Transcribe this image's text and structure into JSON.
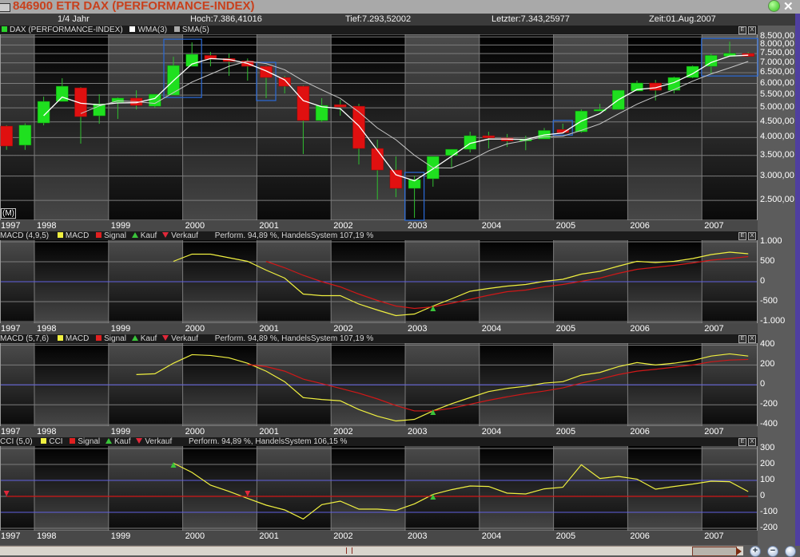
{
  "window": {
    "title": "846900 ETR DAX (PERFORMANCE-INDEX)",
    "period": "1/4 Jahr",
    "high": "Hoch:7.386,41016",
    "low": "Tief:7.293,52002",
    "last": "Letzter:7.343,25977",
    "time": "Zeit:01.Aug.2007",
    "close_label": "✕"
  },
  "main_legend": {
    "series": "DAX (PERFORMANCE-INDEX)",
    "wma": "WMA(3)",
    "sma": "SMA(5)",
    "scale_mode": "(M)"
  },
  "panels": [
    {
      "name": "MACD (4,9,5)",
      "line": "MACD",
      "signal": "Signal",
      "buy": "Kauf",
      "sell": "Verkauf",
      "perf": "Perform. 94,89 %, HandelsSystem 107,19 %"
    },
    {
      "name": "MACD (5,7,6)",
      "line": "MACD",
      "signal": "Signal",
      "buy": "Kauf",
      "sell": "Verkauf",
      "perf": "Perform. 94,89 %, HandelsSystem 107,19 %"
    },
    {
      "name": "CCI (5,0)",
      "line": "CCI",
      "signal": "Signal",
      "buy": "Kauf",
      "sell": "Verkauf",
      "perf": "Perform. 94,89 %, HandelsSystem 106,15 %"
    }
  ],
  "panel_buttons": {
    "menu": "E",
    "close": "X"
  },
  "years": [
    "1997",
    "1998",
    "1999",
    "2000",
    "2001",
    "2002",
    "2003",
    "2004",
    "2005",
    "2006",
    "2007"
  ],
  "zoom_controls": {
    "zoom_in": "+",
    "zoom_out": "−",
    "reset": ""
  },
  "colors": {
    "up": "#1fe01f",
    "down": "#e01010",
    "wick": "#2fc02f",
    "wma": "#ffffff",
    "sma": "#c8c8c8",
    "macd": "#f0f040",
    "signal": "#d01818",
    "buy": "#3ac43a",
    "sell": "#e0283a",
    "highlight": "#2a6ad8",
    "zero_blue": "#6060e0"
  },
  "chart_data": [
    {
      "type": "candlestick",
      "title": "846900 ETR DAX (PERFORMANCE-INDEX)",
      "interval": "quarter",
      "x_start": "1997-Q3",
      "x_end": "2007-Q3",
      "yscale": "log",
      "ylim": [
        2155,
        8665
      ],
      "yticks": [
        {
          "value": 8500,
          "label": "8.500,00"
        },
        {
          "value": 8000,
          "label": "8.000,00"
        },
        {
          "value": 7500,
          "label": "7.500,00"
        },
        {
          "value": 7000,
          "label": "7.000,00"
        },
        {
          "value": 6500,
          "label": "6.500,00"
        },
        {
          "value": 6000,
          "label": "6.000,00"
        },
        {
          "value": 5500,
          "label": "5.500,00"
        },
        {
          "value": 5000,
          "label": "5.000,00"
        },
        {
          "value": 4500,
          "label": "4.500,00"
        },
        {
          "value": 4000,
          "label": "4.000,00"
        },
        {
          "value": 3500,
          "label": "3.500,00"
        },
        {
          "value": 3000,
          "label": "3.000,00"
        },
        {
          "value": 2500,
          "label": "2.500,00"
        }
      ],
      "ohlc": [
        [
          4360,
          4390,
          3650,
          3755
        ],
        [
          3780,
          4450,
          3650,
          4390
        ],
        [
          4464,
          5436,
          4384,
          5245
        ],
        [
          5245,
          6236,
          5245,
          5875
        ],
        [
          5805,
          5840,
          3822,
          4680
        ],
        [
          4710,
          5534,
          4436,
          5150
        ],
        [
          5213,
          5405,
          4600,
          5375
        ],
        [
          5375,
          5700,
          4940,
          5090
        ],
        [
          5060,
          5534,
          5000,
          5534
        ],
        [
          5500,
          7326,
          5500,
          6860
        ],
        [
          6820,
          8158,
          6820,
          7460
        ],
        [
          7400,
          7595,
          6820,
          7196
        ],
        [
          7230,
          7510,
          6350,
          7070
        ],
        [
          7100,
          7230,
          6127,
          6820
        ],
        [
          6820,
          6860,
          5375,
          6273
        ],
        [
          6273,
          6350,
          5567,
          5875
        ],
        [
          5875,
          5910,
          3536,
          4545
        ],
        [
          4545,
          5375,
          4490,
          5090
        ],
        [
          5120,
          5310,
          4710,
          5030
        ],
        [
          5060,
          5150,
          3272,
          3688
        ],
        [
          3688,
          3938,
          2516,
          3138
        ],
        [
          3138,
          3474,
          2562,
          2736
        ],
        [
          2736,
          3010,
          2193,
          2922
        ],
        [
          2940,
          3474,
          2770,
          3474
        ],
        [
          3500,
          3665,
          3200,
          3665
        ],
        [
          3665,
          4180,
          3580,
          4057
        ],
        [
          4057,
          4180,
          3688,
          3990
        ],
        [
          3990,
          4110,
          3730,
          3900
        ],
        [
          3900,
          4057,
          3640,
          3960
        ],
        [
          3960,
          4300,
          3960,
          4220
        ],
        [
          4250,
          4440,
          4150,
          4150
        ],
        [
          4180,
          4940,
          4150,
          4880
        ],
        [
          4880,
          5150,
          4880,
          4940
        ],
        [
          4940,
          5700,
          4940,
          5700
        ],
        [
          5670,
          6127,
          5670,
          6019
        ],
        [
          6019,
          6160,
          5280,
          5700
        ],
        [
          5700,
          6310,
          5567,
          6273
        ],
        [
          6273,
          6860,
          6236,
          6820
        ],
        [
          6820,
          7510,
          6460,
          7400
        ],
        [
          7350,
          8200,
          7350,
          7520
        ],
        [
          7510,
          7590,
          7343,
          7343
        ]
      ],
      "overlays": [
        {
          "name": "WMA(3)",
          "period": 3,
          "kind": "wma"
        },
        {
          "name": "SMA(5)",
          "period": 5,
          "kind": "sma"
        }
      ],
      "highlight_ranges": [
        [
          9,
          10
        ],
        [
          14,
          14
        ],
        [
          22,
          22
        ],
        [
          30,
          30
        ],
        [
          38,
          40
        ]
      ]
    },
    {
      "type": "line",
      "title": "MACD (4,9,5)",
      "ylim": [
        -1040,
        1060
      ],
      "yticks": [
        {
          "value": 1000,
          "label": "1.000"
        },
        {
          "value": 500,
          "label": "500"
        },
        {
          "value": 0,
          "label": "0"
        },
        {
          "value": -500,
          "label": "-500"
        },
        {
          "value": -1000,
          "label": "-1.000"
        }
      ],
      "reference_lines": [
        0
      ],
      "series": [
        {
          "name": "MACD",
          "start_index": 9,
          "values": [
            510,
            690,
            690,
            600,
            510,
            290,
            90,
            -310,
            -350,
            -350,
            -560,
            -710,
            -850,
            -810,
            -610,
            -430,
            -240,
            -170,
            -110,
            -70,
            10,
            60,
            190,
            260,
            390,
            510,
            480,
            510,
            580,
            680,
            740,
            700
          ]
        },
        {
          "name": "Signal",
          "start_index": 14,
          "values": [
            510,
            350,
            160,
            0,
            -130,
            -310,
            -470,
            -610,
            -670,
            -630,
            -540,
            -440,
            -340,
            -250,
            -210,
            -130,
            -70,
            10,
            90,
            210,
            310,
            360,
            410,
            470,
            540,
            580,
            630
          ]
        }
      ],
      "buy_signals": [
        {
          "index": 23,
          "value": -660
        }
      ],
      "sell_signals": []
    },
    {
      "type": "line",
      "title": "MACD (5,7,6)",
      "ylim": [
        -415,
        420
      ],
      "yticks": [
        {
          "value": 400,
          "label": "400"
        },
        {
          "value": 200,
          "label": "200"
        },
        {
          "value": 0,
          "label": "0"
        },
        {
          "value": -200,
          "label": "-200"
        },
        {
          "value": -400,
          "label": "-400"
        }
      ],
      "reference_lines": [
        0
      ],
      "series": [
        {
          "name": "MACD",
          "start_index": 7,
          "values": [
            104,
            112,
            218,
            304,
            296,
            272,
            218,
            138,
            32,
            -128,
            -147,
            -160,
            -248,
            -315,
            -363,
            -347,
            -262,
            -190,
            -128,
            -67,
            -35,
            -14,
            18,
            32,
            98,
            125,
            184,
            224,
            200,
            218,
            245,
            290,
            312,
            290
          ]
        },
        {
          "name": "Signal",
          "start_index": 13,
          "values": [
            205,
            184,
            138,
            58,
            13,
            -35,
            -83,
            -141,
            -208,
            -262,
            -262,
            -235,
            -195,
            -155,
            -120,
            -88,
            -62,
            -30,
            18,
            58,
            104,
            138,
            157,
            178,
            200,
            232,
            250,
            256
          ]
        }
      ],
      "buy_signals": [
        {
          "index": 23,
          "value": -270
        }
      ],
      "sell_signals": []
    },
    {
      "type": "line",
      "title": "CCI (5,0)",
      "ylim": [
        -215,
        320
      ],
      "yticks": [
        {
          "value": 300,
          "label": "300"
        },
        {
          "value": 200,
          "label": "200"
        },
        {
          "value": 100,
          "label": "100"
        },
        {
          "value": 0,
          "label": "0"
        },
        {
          "value": -100,
          "label": "-100"
        },
        {
          "value": -200,
          "label": "-200"
        }
      ],
      "reference_lines": [
        100,
        -100
      ],
      "series": [
        {
          "name": "CCI",
          "start_index": 9,
          "values": [
            208,
            150,
            70,
            31,
            -13,
            -55,
            -85,
            -142,
            -52,
            -30,
            -80,
            -80,
            -88,
            -47,
            12,
            42,
            65,
            62,
            20,
            15,
            47,
            57,
            198,
            112,
            125,
            108,
            45,
            62,
            77,
            95,
            92,
            30
          ]
        },
        {
          "name": "Signal",
          "start_index": 0,
          "values": [
            0,
            0,
            0,
            0,
            0,
            0,
            0,
            0,
            0,
            0,
            0,
            0,
            0,
            0,
            0,
            0,
            0,
            0,
            0,
            0,
            0,
            0,
            0,
            0,
            0,
            0,
            0,
            0,
            0,
            0,
            0,
            0,
            0,
            0,
            0,
            0,
            0,
            0,
            0,
            0,
            0
          ]
        }
      ],
      "buy_signals": [
        {
          "index": 9,
          "value": 200
        },
        {
          "index": 23,
          "value": 0
        }
      ],
      "sell_signals": [
        {
          "index": 0,
          "value": 0
        },
        {
          "index": 13,
          "value": 0
        }
      ]
    }
  ]
}
